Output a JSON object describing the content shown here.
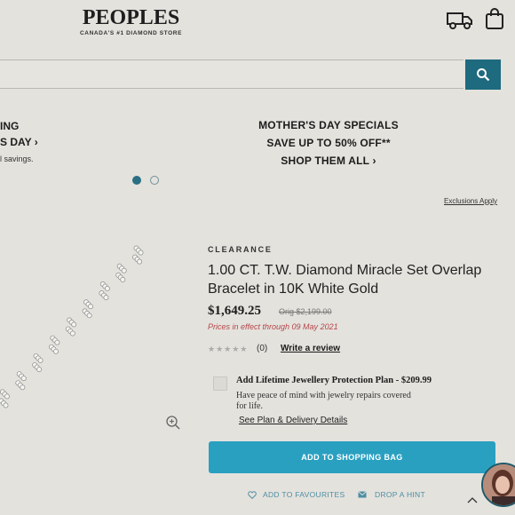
{
  "header": {
    "logo_main": "PEOPLES",
    "logo_sub": "CANADA'S #1 DIAMOND STORE",
    "truck_icon": "truck-icon",
    "bag_icon": "shopping-bag-icon"
  },
  "search": {
    "value": "",
    "icon": "search-icon",
    "accent": "#1e6a7e"
  },
  "banner": {
    "left_line1": "ING",
    "left_line2": "S DAY ›",
    "left_line3": "l savings.",
    "center_line1": "MOTHER'S DAY SPECIALS",
    "center_line2": "SAVE UP TO 50% OFF**",
    "center_line3": "SHOP THEM ALL ›",
    "exclusions": "Exclusions Apply"
  },
  "product": {
    "tag": "CLEARANCE",
    "title": "1.00 CT. T.W. Diamond Miracle Set Overlap Bracelet in 10K White Gold",
    "price": "$1,649.25",
    "orig_price": "Orig $2,199.00",
    "effect": "Prices in effect through 09 May 2021",
    "review_count": "(0)",
    "write_review": "Write a review",
    "rating": 0
  },
  "protection": {
    "title": "Add Lifetime Jewellery Protection Plan - $209.99",
    "desc": "Have peace of mind with jewelry repairs covered for life.",
    "link": "See Plan & Delivery Details"
  },
  "actions": {
    "add_to_bag": "ADD TO SHOPPING BAG",
    "favourites": "ADD TO FAVOURITES",
    "hint": "DROP A HINT",
    "button_color": "#2aa0c1"
  }
}
